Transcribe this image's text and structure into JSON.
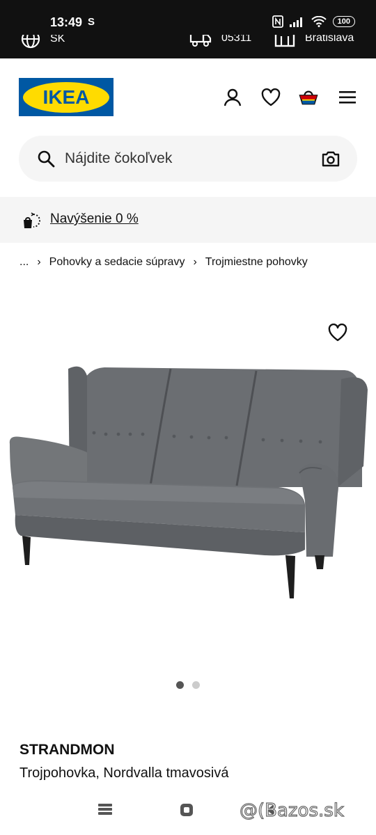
{
  "status_bar": {
    "time": "13:49",
    "carrier_mark": "S",
    "battery": "100"
  },
  "top_strip": {
    "language": "SK",
    "postal_code": "05311",
    "store": "Bratislava"
  },
  "header": {
    "logo_text": "IKEA"
  },
  "search": {
    "placeholder": "Nájdite čokoľvek"
  },
  "promo": {
    "text": "Navýšenie 0 %"
  },
  "breadcrumb": {
    "ellipsis": "...",
    "items": [
      "Pohovky a sedacie súpravy",
      "Trojmiestne pohovky"
    ]
  },
  "gallery": {
    "image_count": 2,
    "active_index": 0
  },
  "product": {
    "name": "STRANDMON",
    "description": "Trojpohovka, Nordvalla tmavosivá",
    "color": "#6b6e72"
  },
  "watermark": {
    "text": "@(Bazos.sk"
  },
  "colors": {
    "ikea_blue": "#0058a3",
    "ikea_yellow": "#ffdb00",
    "status_bg": "#111111"
  }
}
